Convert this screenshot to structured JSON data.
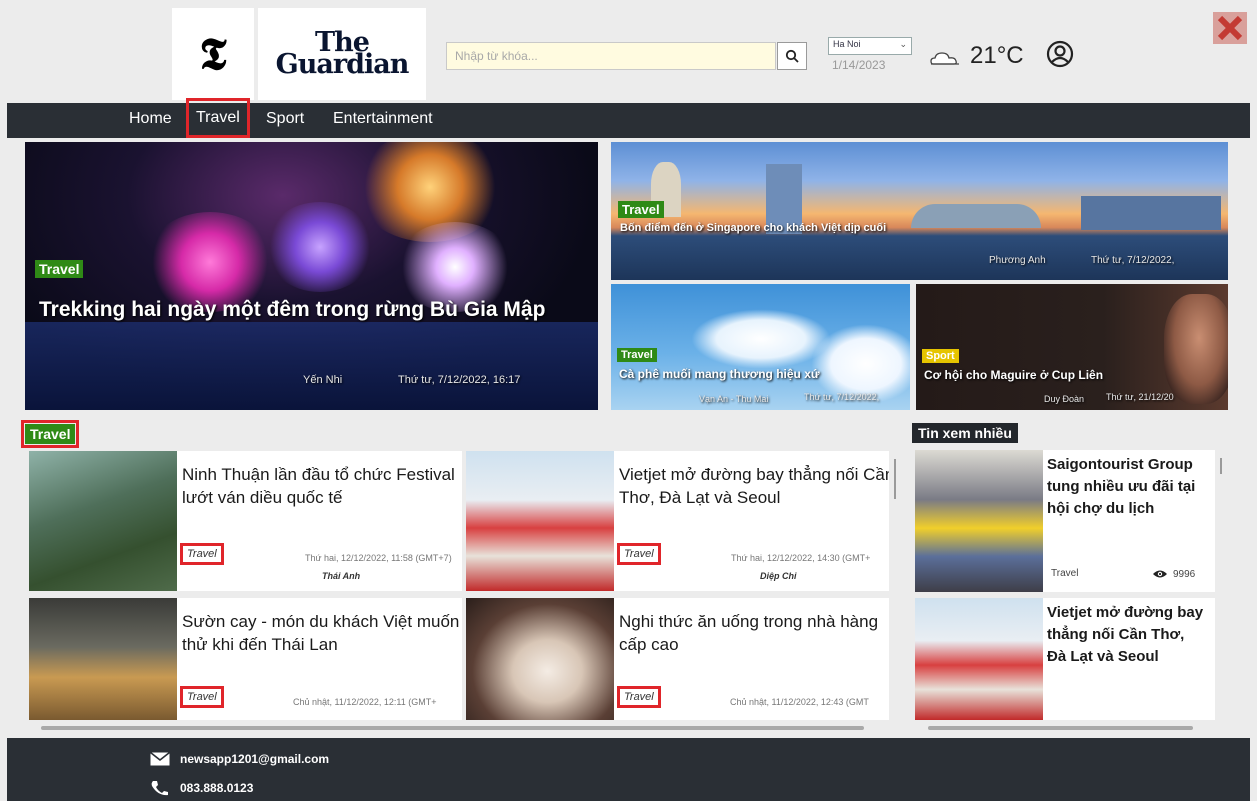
{
  "logos": {
    "nyt": "𝕿",
    "guardian_line1": "The",
    "guardian_line2": "Guardian"
  },
  "search": {
    "placeholder": "Nhập từ khóa..."
  },
  "location": {
    "city": "Ha Noi",
    "date": "1/14/2023",
    "temperature": "21°C"
  },
  "icons": {
    "search": "search-icon",
    "weather": "cloud-icon",
    "user": "user-icon",
    "close": "close-icon",
    "mail": "mail-icon",
    "phone": "phone-icon",
    "views": "eye-icon"
  },
  "colors": {
    "nav_bg": "#2a2f35",
    "tag_travel": "#2f8a16",
    "tag_sport": "#e6c400",
    "highlight": "#e0252a"
  },
  "nav": {
    "items": [
      "Home",
      "Travel",
      "Sport",
      "Entertainment"
    ],
    "active": "Travel"
  },
  "hero": {
    "main": {
      "tag": "Travel",
      "title": "Trekking hai ngày một đêm trong rừng Bù Gia Mập",
      "author": "Yến Nhi",
      "date": "Thứ tư, 7/12/2022, 16:17"
    },
    "top_right": {
      "tag": "Travel",
      "title": "Bốn điểm đến ở Singapore cho khách Việt dịp cuối",
      "author": "Phương Anh",
      "date": "Thứ tư, 7/12/2022,"
    },
    "bottom_left": {
      "tag": "Travel",
      "title": "Cà phê muối mang thương hiệu xứ",
      "author": "Vạn An - Thu Mai",
      "date": "Thứ tư, 7/12/2022,"
    },
    "bottom_right": {
      "tag": "Sport",
      "title": "Cơ hội cho Maguire ở Cup Liên",
      "author": "Duy Đoàn",
      "date": "Thứ tư, 21/12/20"
    }
  },
  "sections": {
    "travel": "Travel",
    "most_viewed": "Tin xem nhiều"
  },
  "articles": [
    {
      "title": "Ninh Thuận lần đầu tổ chức Festival lướt ván diều quốc tế",
      "tag": "Travel",
      "date": "Thứ hai, 12/12/2022, 11:58 (GMT+7)",
      "author": "Thái Anh"
    },
    {
      "title": "Vietjet mở đường bay thẳng nối Cần Thơ, Đà Lạt và Seoul",
      "tag": "Travel",
      "date": "Thứ hai, 12/12/2022, 14:30 (GMT+",
      "author": "Diệp Chi"
    },
    {
      "title": "Sườn cay - món du khách Việt muốn thử khi đến Thái Lan",
      "tag": "Travel",
      "date": "Chủ nhật, 11/12/2022, 12:11 (GMT+",
      "author": ""
    },
    {
      "title": "Nghi thức ăn uống trong nhà hàng cấp cao",
      "tag": "Travel",
      "date": "Chủ nhật, 11/12/2022, 12:43 (GMT",
      "author": ""
    }
  ],
  "most_viewed": [
    {
      "title": "Saigontourist Group tung nhiều ưu đãi tại hội chợ du lịch",
      "tag": "Travel",
      "views": "9996"
    },
    {
      "title": "Vietjet mở đường bay thẳng nối Cần Thơ, Đà Lạt và Seoul",
      "tag": "",
      "views": ""
    }
  ],
  "footer": {
    "email": "newsapp1201@gmail.com",
    "phone": "083.888.0123"
  }
}
